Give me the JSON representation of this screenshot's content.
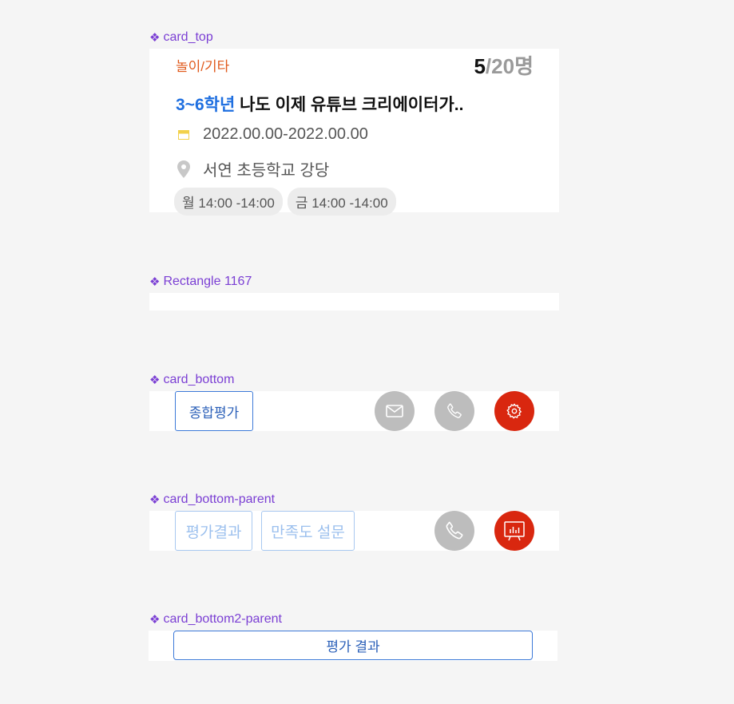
{
  "labels": {
    "card_top": "card_top",
    "rectangle": "Rectangle 1167",
    "card_bottom": "card_bottom",
    "card_bottom_parent": "card_bottom-parent",
    "card_bottom2_parent": "card_bottom2-parent",
    "marker": "❖"
  },
  "card_top": {
    "category": "놀이/기타",
    "count_current": "5",
    "count_total": "/20명",
    "grade": "3~6학년",
    "title": " 나도 이제 유튜브 크리에이터가..",
    "date_range": "2022.00.00-2022.00.00",
    "location": "서연 초등학교 강당",
    "schedule": [
      "월 14:00 -14:00",
      "금 14:00 -14:00"
    ]
  },
  "card_bottom": {
    "evaluate_button": "종합평가",
    "icons": [
      "mail-icon",
      "phone-icon",
      "settings-icon"
    ]
  },
  "card_bottom_parent": {
    "result_button": "평가결과",
    "survey_button": "만족도 설문",
    "icons": [
      "phone-icon",
      "presentation-chart-icon"
    ]
  },
  "card_bottom2_parent": {
    "result_button": "평가 결과"
  },
  "colors": {
    "accent_blue": "#1f6fe0",
    "category_orange": "#e05a1c",
    "label_purple": "#7b3fd4",
    "action_red": "#d9270f",
    "action_gray": "#bdbdbd"
  }
}
